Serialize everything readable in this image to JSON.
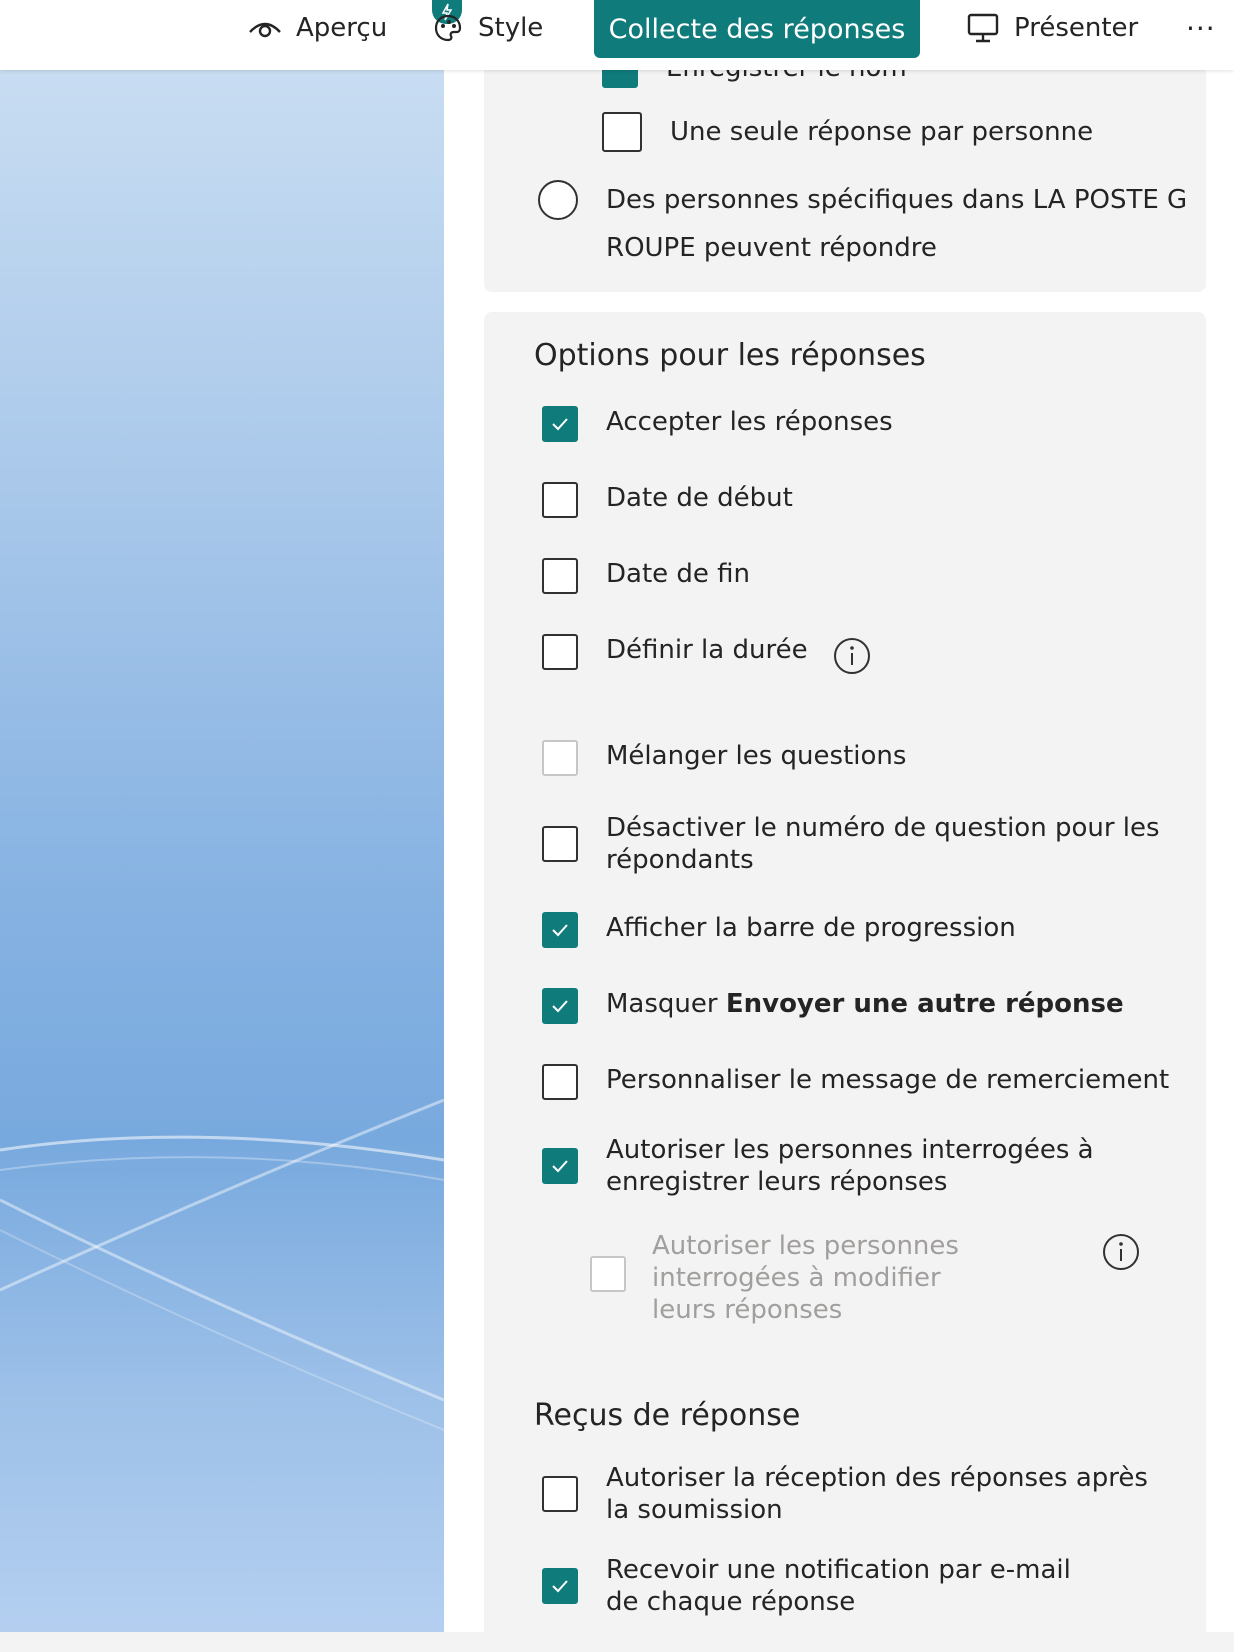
{
  "topbar": {
    "preview": "Aperçu",
    "style": "Style",
    "collect": "Collecte des réponses",
    "present": "Présenter",
    "more": "···"
  },
  "access": {
    "record_name": "Enregistrer le nom",
    "one_response": "Une seule réponse par personne",
    "specific_people_line1": "Des personnes spécifiques dans LA POSTE G",
    "specific_people_line2": "ROUPE peuvent répondre"
  },
  "options": {
    "title": "Options pour les réponses",
    "items": [
      {
        "label": "Accepter les réponses",
        "checked": true
      },
      {
        "label": "Date de début",
        "checked": false
      },
      {
        "label": "Date de fin",
        "checked": false
      },
      {
        "label": "Définir la durée",
        "checked": false
      },
      {
        "label": "Mélanger les questions",
        "checked": false
      },
      {
        "label": "Désactiver le numéro de question pour les répondants",
        "checked": false
      },
      {
        "label": "Afficher la barre de progression",
        "checked": true
      },
      {
        "label_prefix": "Masquer ",
        "label_bold": "Envoyer une autre réponse",
        "checked": true
      },
      {
        "label": "Personnaliser le message de remerciement",
        "checked": false
      },
      {
        "label": "Autoriser les personnes interrogées à enregistrer leurs réponses",
        "checked": true
      },
      {
        "label": "Autoriser les personnes interrogées à modifier leurs réponses",
        "checked": false,
        "disabled": true
      }
    ]
  },
  "receipts": {
    "title": "Reçus de réponse",
    "items": [
      {
        "label": "Autoriser la réception des réponses après la soumission",
        "checked": false
      },
      {
        "label": "Recevoir une notification par e-mail de chaque réponse",
        "checked": true
      }
    ]
  },
  "colors": {
    "accent": "#0f7b7b",
    "panel": "#f3f3f3"
  }
}
